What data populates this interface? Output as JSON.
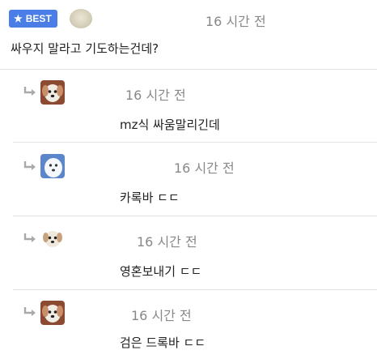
{
  "main": {
    "badge_label": "BEST",
    "badge_icon": "star-icon",
    "time": "16 시간 전",
    "text": "싸우지 말라고 기도하는건데?"
  },
  "replies": [
    {
      "time": "16 시간 전",
      "text": "mz식 싸움말리긴데",
      "avatar": "puppy-avatar"
    },
    {
      "time": "16 시간 전",
      "text": "카록바 ㄷㄷ",
      "avatar": "blue-dog-avatar"
    },
    {
      "time": "16 시간 전",
      "text": "영혼보내기 ㄷㄷ",
      "avatar": "puppy-avatar"
    },
    {
      "time": "16 시간 전",
      "text": "검은 드록바 ㄷㄷ",
      "avatar": "puppy-avatar"
    }
  ],
  "colors": {
    "badge": "#4a7de6",
    "reply_arrow": "#a9a9a9",
    "time": "#888888"
  }
}
